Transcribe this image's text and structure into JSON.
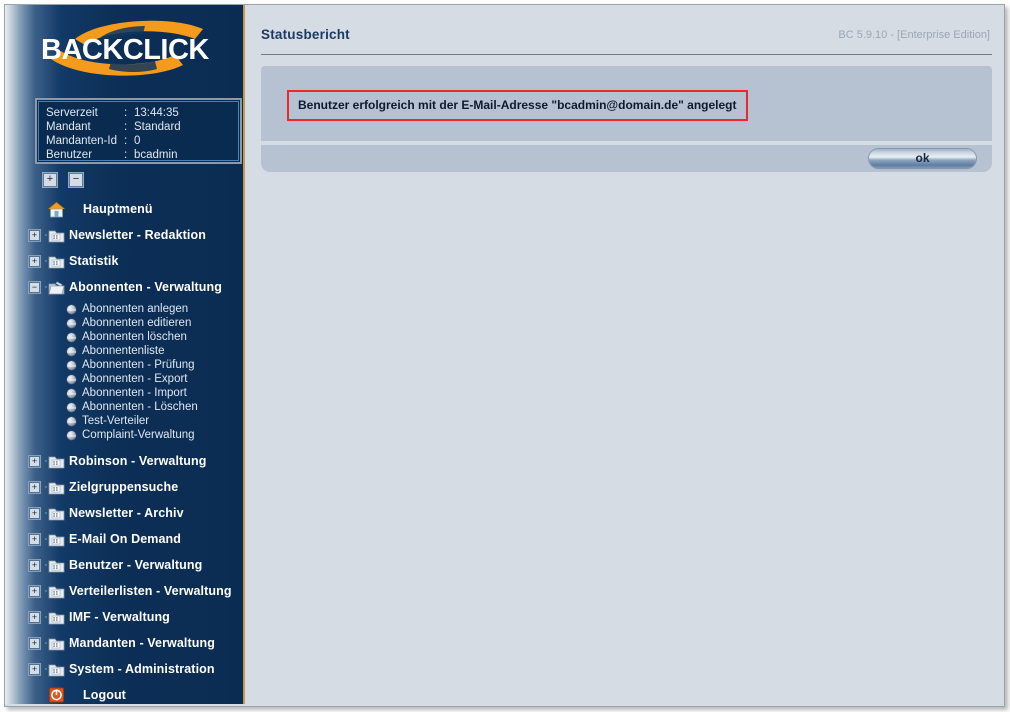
{
  "brand": {
    "logo_text": "BACKCLICK",
    "accent_color": "#f59b1b",
    "sidebar_color": "#0b2c52",
    "panel_color": "#b6c2d2",
    "background_color": "#d6dce4",
    "alert_border_color": "#e8292e"
  },
  "sidebar": {
    "info": {
      "rows": [
        {
          "label": "Serverzeit",
          "colon": ":",
          "value": "13:44:35"
        },
        {
          "label": "Mandant",
          "colon": ":",
          "value": "Standard"
        },
        {
          "label": "Mandanten-Id",
          "colon": ":",
          "value": "0"
        },
        {
          "label": "Benutzer",
          "colon": ":",
          "value": "bcadmin"
        }
      ]
    },
    "tools": {
      "expand_all": "+",
      "collapse_all": "−"
    },
    "nodes": [
      {
        "label": "Hauptmenü",
        "icon": "house-icon",
        "toggle": null,
        "expanded": false,
        "children": []
      },
      {
        "label": "Newsletter - Redaktion",
        "icon": "folder-closed-icon",
        "toggle": "+",
        "expanded": false,
        "children": []
      },
      {
        "label": "Statistik",
        "icon": "folder-closed-icon",
        "toggle": "+",
        "expanded": false,
        "children": []
      },
      {
        "label": "Abonnenten - Verwaltung",
        "icon": "folder-open-icon",
        "toggle": "−",
        "expanded": true,
        "children": [
          "Abonnenten anlegen",
          "Abonnenten editieren",
          "Abonnenten löschen",
          "Abonnentenliste",
          "Abonnenten - Prüfung",
          "Abonnenten - Export",
          "Abonnenten - Import",
          "Abonnenten - Löschen",
          "Test-Verteiler",
          "Complaint-Verwaltung"
        ]
      },
      {
        "label": "Robinson - Verwaltung",
        "icon": "folder-closed-icon",
        "toggle": "+",
        "expanded": false,
        "children": []
      },
      {
        "label": "Zielgruppensuche",
        "icon": "folder-closed-icon",
        "toggle": "+",
        "expanded": false,
        "children": []
      },
      {
        "label": "Newsletter - Archiv",
        "icon": "folder-closed-icon",
        "toggle": "+",
        "expanded": false,
        "children": []
      },
      {
        "label": "E-Mail On Demand",
        "icon": "folder-closed-icon",
        "toggle": "+",
        "expanded": false,
        "children": []
      },
      {
        "label": "Benutzer - Verwaltung",
        "icon": "folder-closed-icon",
        "toggle": "+",
        "expanded": false,
        "children": []
      },
      {
        "label": "Verteilerlisten - Verwaltung",
        "icon": "folder-closed-icon",
        "toggle": "+",
        "expanded": false,
        "children": []
      },
      {
        "label": "IMF - Verwaltung",
        "icon": "folder-closed-icon",
        "toggle": "+",
        "expanded": false,
        "children": []
      },
      {
        "label": "Mandanten - Verwaltung",
        "icon": "folder-closed-icon",
        "toggle": "+",
        "expanded": false,
        "children": []
      },
      {
        "label": "System - Administration",
        "icon": "folder-closed-icon",
        "toggle": "+",
        "expanded": false,
        "children": []
      },
      {
        "label": "Logout",
        "icon": "power-icon",
        "toggle": null,
        "expanded": false,
        "children": []
      }
    ]
  },
  "main": {
    "page_title": "Statusbericht",
    "version_info": "BC 5.9.10 - [Enterprise Edition]",
    "message": "Benutzer erfolgreich mit der E-Mail-Adresse \"bcadmin@domain.de\" angelegt",
    "ok_label": "ok"
  }
}
